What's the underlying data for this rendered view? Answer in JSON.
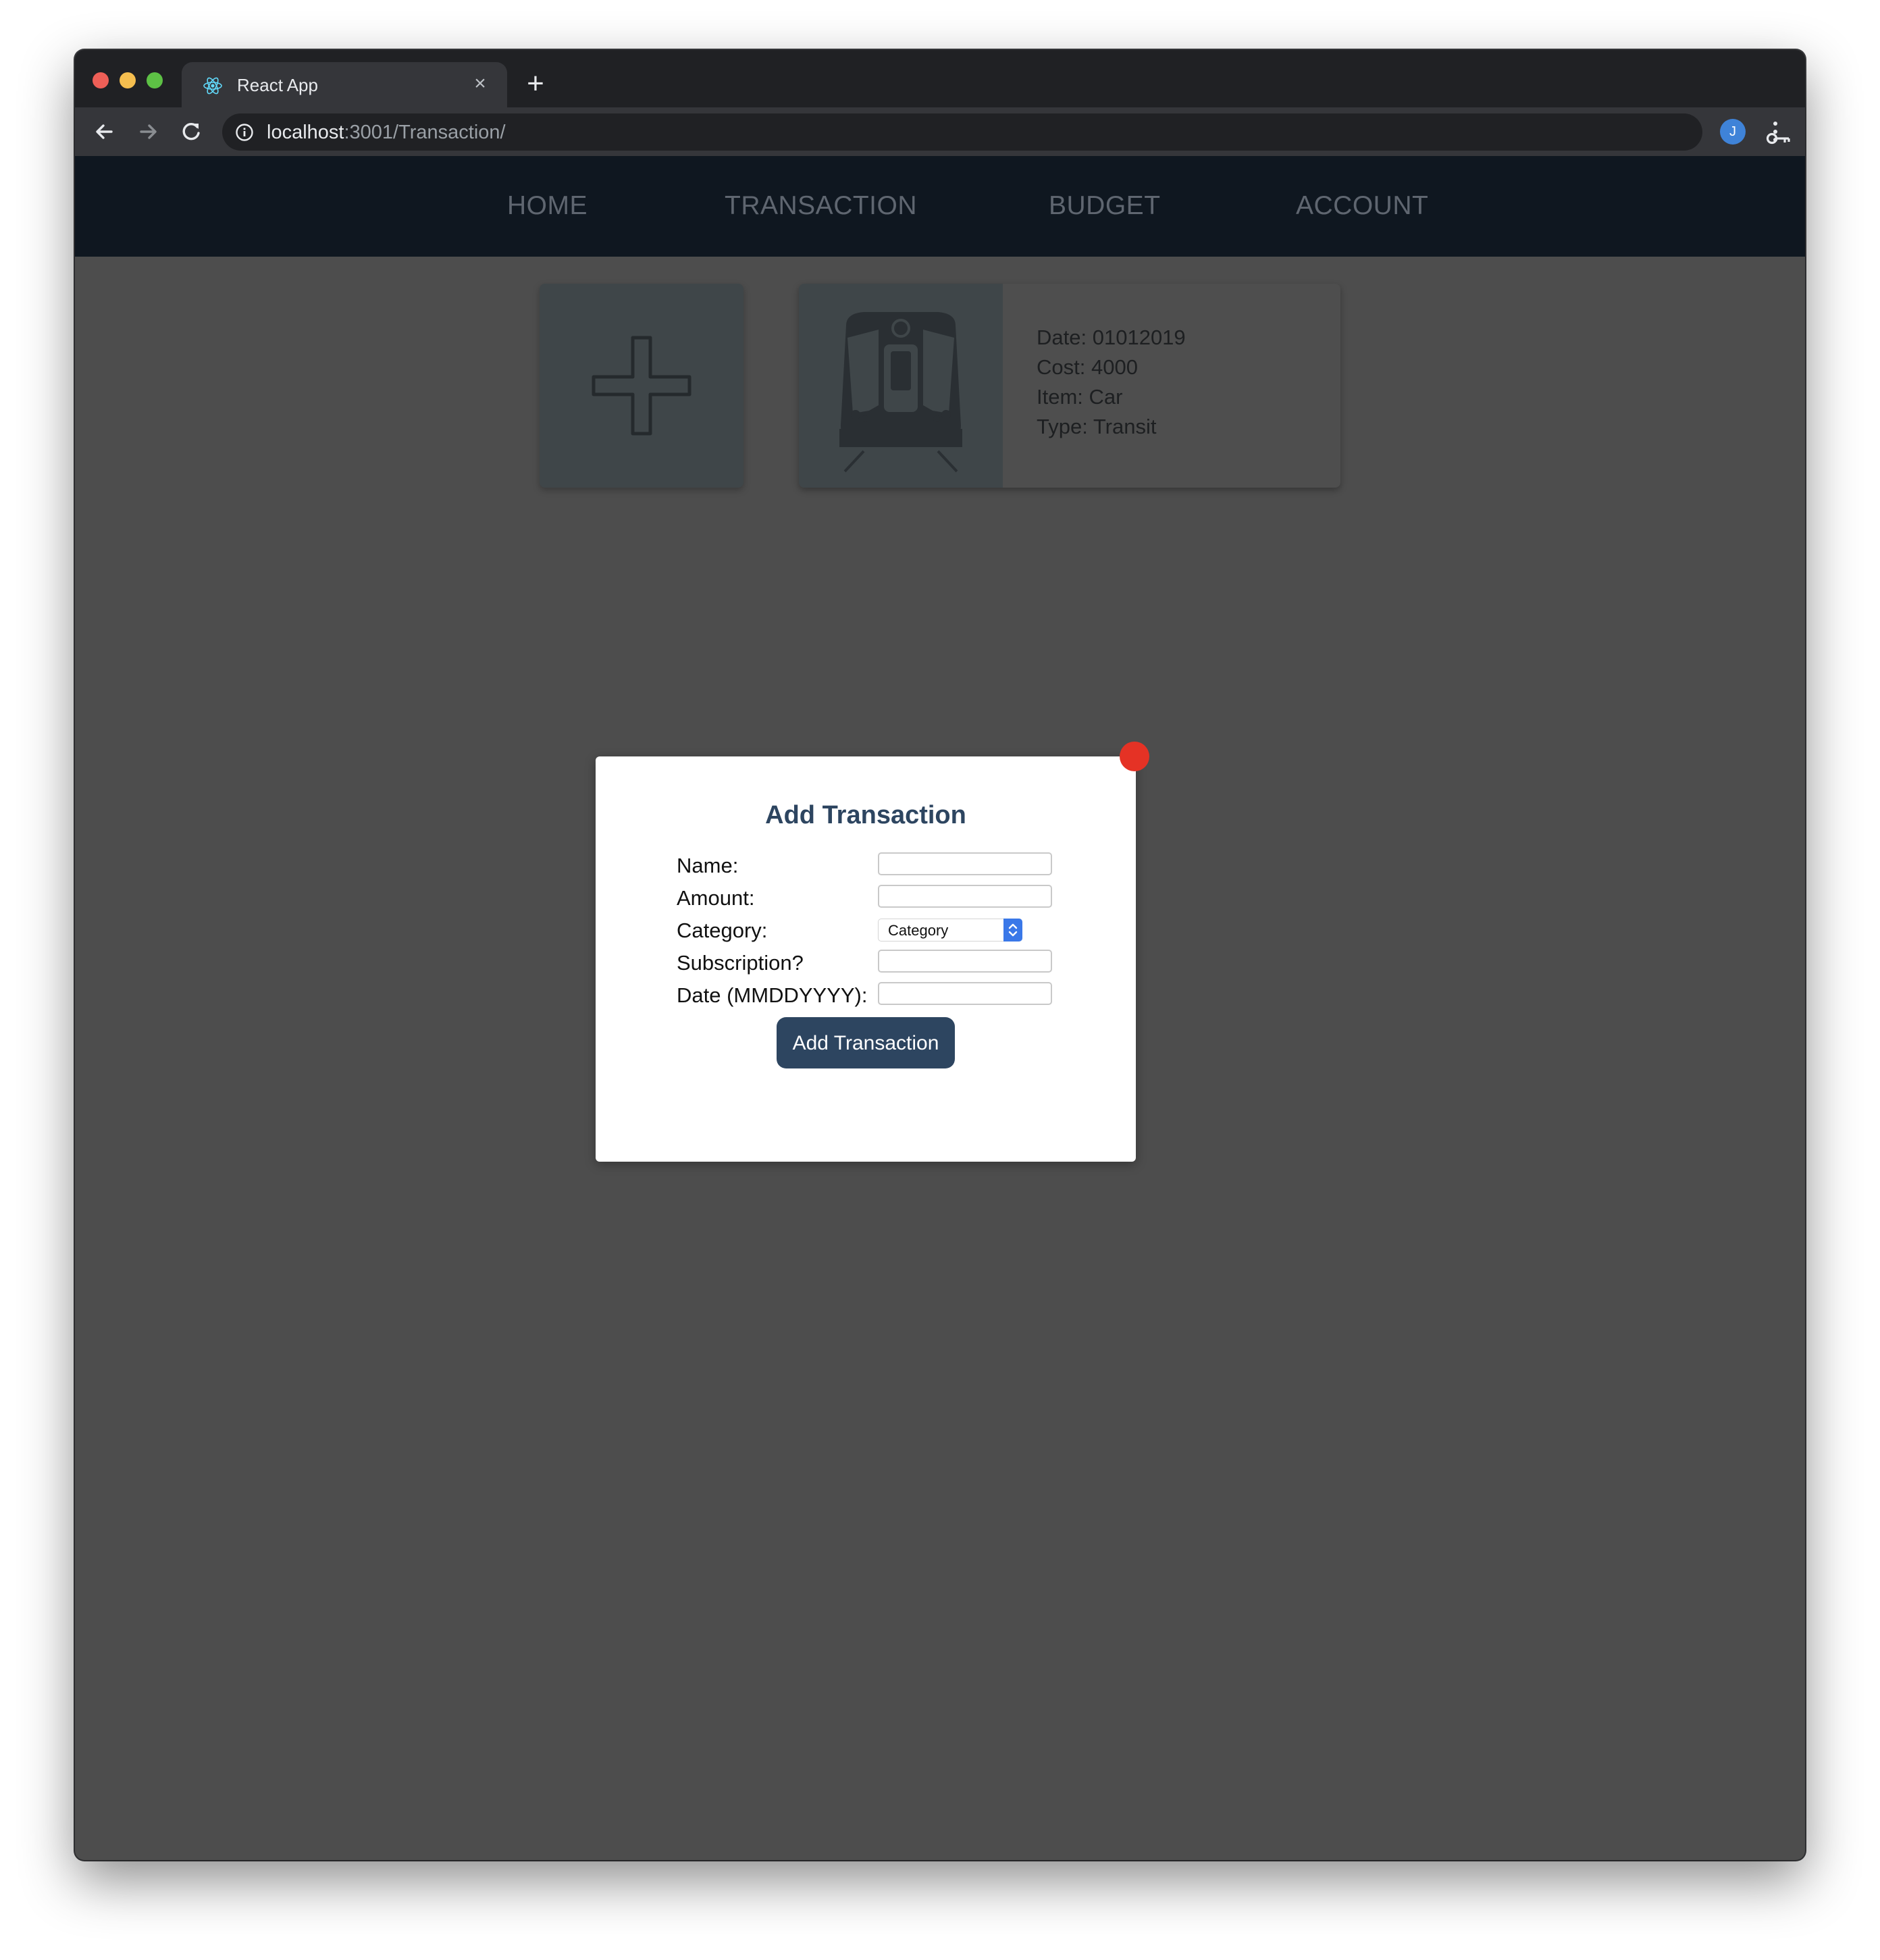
{
  "browser": {
    "tab_title": "React App",
    "url_host": "localhost",
    "url_rest": ":3001/Transaction/",
    "avatar_initial": "J"
  },
  "nav": {
    "items": [
      {
        "label": "HOME"
      },
      {
        "label": "TRANSACTION"
      },
      {
        "label": "BUDGET"
      },
      {
        "label": "ACCOUNT"
      }
    ]
  },
  "transaction_card": {
    "date_label": "Date:",
    "date_value": "01012019",
    "cost_label": "Cost:",
    "cost_value": "4000",
    "item_label": "Item:",
    "item_value": "Car",
    "type_label": "Type:",
    "type_value": "Transit",
    "icon": "train-icon"
  },
  "modal": {
    "title": "Add Transaction",
    "fields": [
      {
        "label": "Name:",
        "value": ""
      },
      {
        "label": "Amount:",
        "value": ""
      },
      {
        "label": "Category:",
        "value": "Category"
      },
      {
        "label": "Subscription?",
        "value": ""
      },
      {
        "label": "Date (MMDDYYYY):",
        "value": ""
      }
    ],
    "submit_label": "Add Transaction"
  },
  "colors": {
    "nav_bg": "#0f1720",
    "page_bg": "#4d4d4d",
    "accent": "#2d4560",
    "close_red": "#e53225"
  }
}
